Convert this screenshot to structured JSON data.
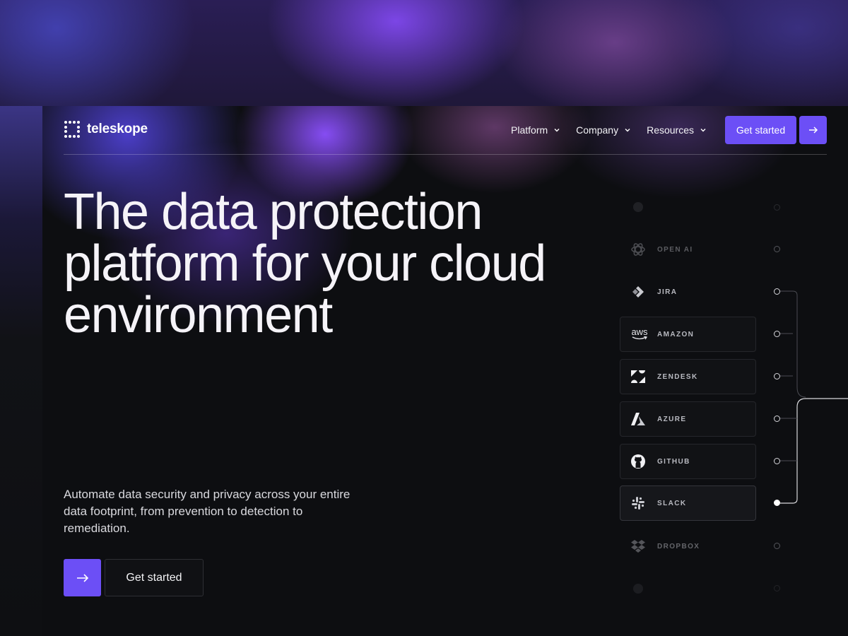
{
  "brand": {
    "name": "teleskope"
  },
  "nav": {
    "items": [
      {
        "label": "Platform"
      },
      {
        "label": "Company"
      },
      {
        "label": "Resources"
      }
    ],
    "cta_label": "Get started"
  },
  "hero": {
    "headline": "The data protection platform for your cloud environment",
    "subtext": "Automate data security and privacy across your entire data footprint, from prevention to detection to remediation.",
    "cta_label": "Get started"
  },
  "integrations": [
    {
      "label": "",
      "icon": "generic-icon"
    },
    {
      "label": "OPEN AI",
      "icon": "openai-icon"
    },
    {
      "label": "JIRA",
      "icon": "jira-icon"
    },
    {
      "label": "AMAZON",
      "icon": "aws-icon",
      "icon_text": "aws"
    },
    {
      "label": "ZENDESK",
      "icon": "zendesk-icon"
    },
    {
      "label": "AZURE",
      "icon": "azure-icon"
    },
    {
      "label": "GITHUB",
      "icon": "github-icon"
    },
    {
      "label": "SLACK",
      "icon": "slack-icon"
    },
    {
      "label": "DROPBOX",
      "icon": "dropbox-icon"
    },
    {
      "label": "",
      "icon": "generic-icon"
    }
  ],
  "colors": {
    "accent": "#6c4ff6",
    "background": "#0d0e11"
  }
}
